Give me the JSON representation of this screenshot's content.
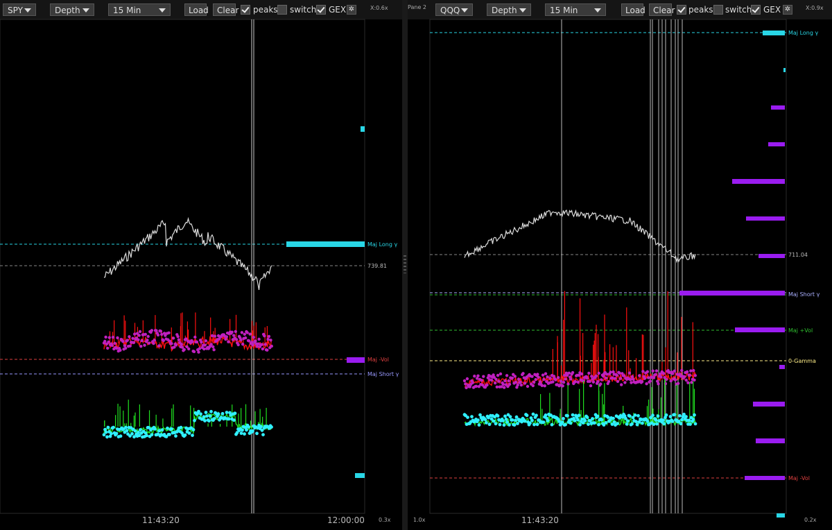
{
  "colors": {
    "long_gamma": "#29d6e6",
    "short_gamma": "#9999ff",
    "neg_vol": "#e04040",
    "pos_vol": "#2fbf2f",
    "zero_gamma": "#ffee88",
    "price": "#dddddd",
    "magenta_series": "#c020c0",
    "red_series": "#ff1010",
    "cyan_series": "#30f0ff",
    "green_series": "#20e020",
    "histogram": "#9a1cf0"
  },
  "left": {
    "toolbar": {
      "symbol": "SPY",
      "mode": "Depth",
      "interval": "15 Min",
      "load_label": "Load",
      "clear_label": "Clear",
      "peaks_label": "peaks",
      "switch_label": "switch",
      "gex_label": "GEX",
      "zoom_x": "X:0.6x"
    },
    "levels": {
      "maj_long": "Maj Long γ",
      "price": "739.81",
      "maj_neg_vol": "Maj -Vol",
      "maj_short": "Maj Short γ"
    },
    "time_labels": [
      "11:43:20",
      "12:00:00"
    ],
    "zoom_y": "0.3x"
  },
  "right": {
    "pane_label": "Pane 2",
    "toolbar": {
      "symbol": "QQQ",
      "mode": "Depth",
      "interval": "15 Min",
      "load_label": "Load",
      "clear_label": "Clear",
      "peaks_label": "peaks",
      "switch_label": "switch",
      "gex_label": "GEX",
      "zoom_x": "X:0.9x"
    },
    "levels": {
      "maj_long": "Maj Long γ",
      "price": "711.04",
      "maj_short": "Maj Short γ",
      "maj_pos_vol": "Maj +Vol",
      "zero_gamma": "0-Gamma",
      "maj_neg_vol": "Maj -Vol"
    },
    "time_labels": [
      "11:43:20"
    ],
    "zoom_left": "1.0x",
    "zoom_y": "0.2x"
  },
  "toggles": {
    "peaks": true,
    "switch": false,
    "gex": true
  }
}
